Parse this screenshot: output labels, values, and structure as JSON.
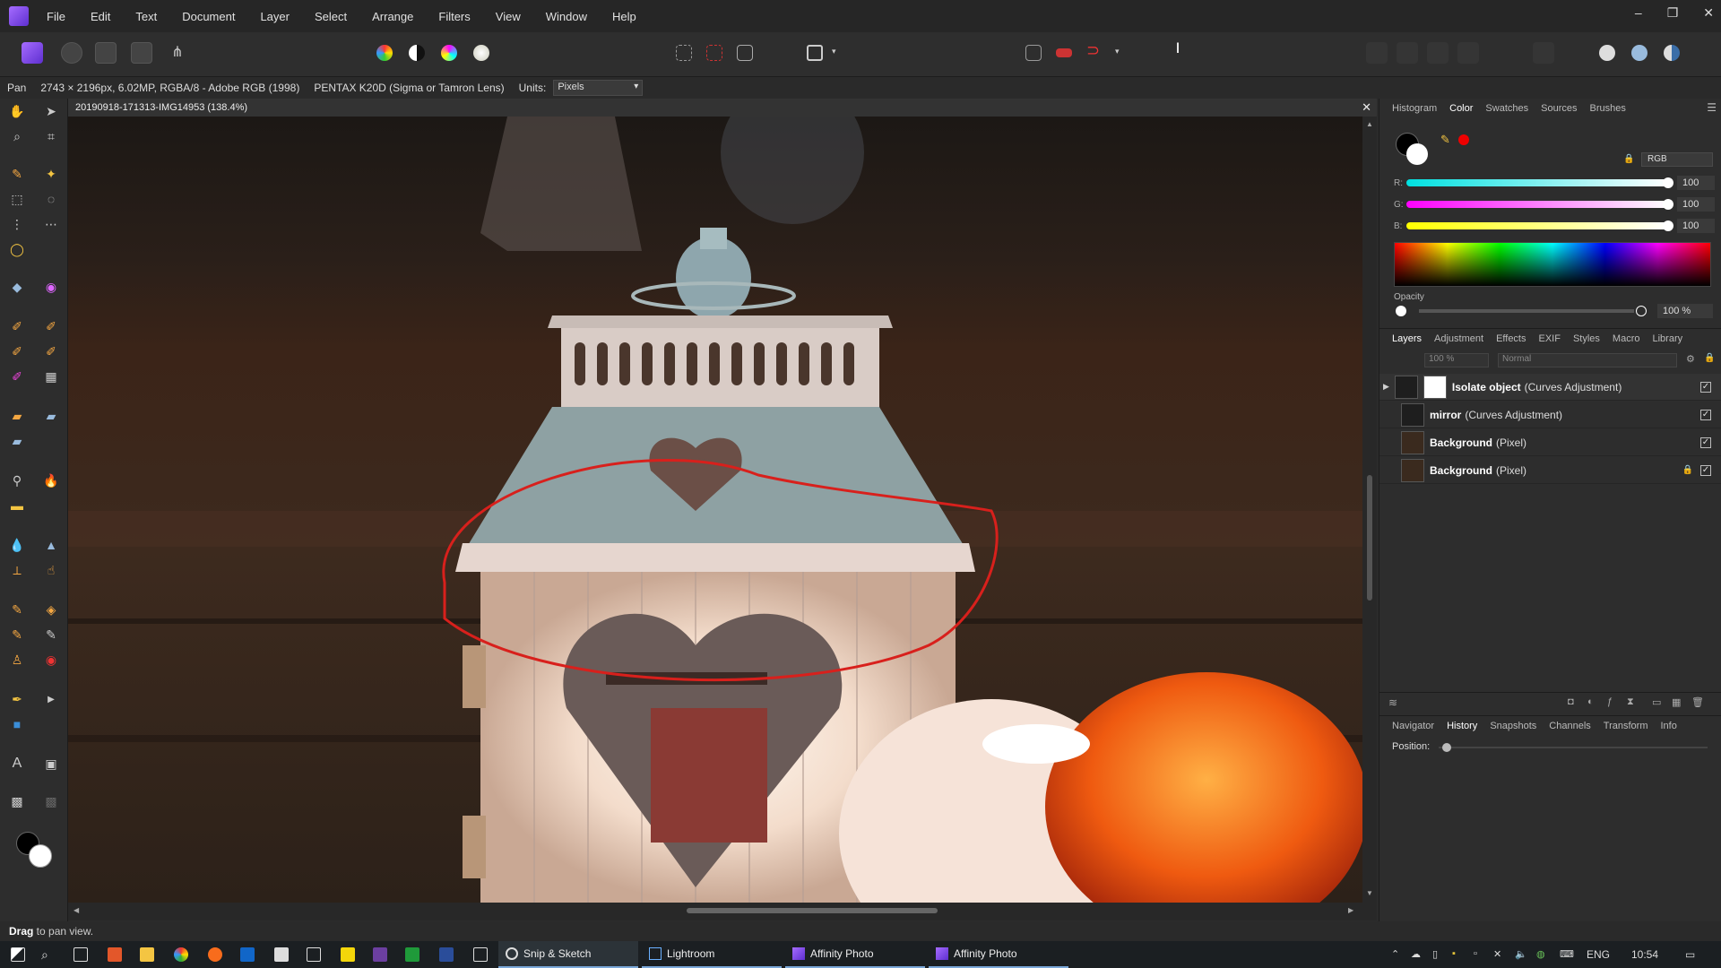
{
  "menu": [
    "File",
    "Edit",
    "Text",
    "Document",
    "Layer",
    "Select",
    "Arrange",
    "Filters",
    "View",
    "Window",
    "Help"
  ],
  "window_controls": [
    "–",
    "❐",
    "✕"
  ],
  "context": {
    "tool": "Pan",
    "info": "2743 × 2196px, 6.02MP, RGBA/8 - Adobe RGB (1998)",
    "camera": "PENTAX K20D (Sigma or Tamron Lens)",
    "units_label": "Units:",
    "units_value": "Pixels"
  },
  "document_tab": {
    "title": "20190918-171313-IMG14953 (138.4%)",
    "close": "✕"
  },
  "color_panel": {
    "tabs": [
      "Histogram",
      "Color",
      "Swatches",
      "Sources",
      "Brushes"
    ],
    "active_tab": "Color",
    "mode": "RGB",
    "channels": [
      {
        "label": "R:",
        "value": "100",
        "gradient": "linear-gradient(90deg,#00e0e0,#ffffff)"
      },
      {
        "label": "G:",
        "value": "100",
        "gradient": "linear-gradient(90deg,#ff00ff,#ffffff)"
      },
      {
        "label": "B:",
        "value": "100",
        "gradient": "linear-gradient(90deg,#ffff00,#ffffff)"
      }
    ],
    "opacity_label": "Opacity",
    "opacity_value": "100 %"
  },
  "layers_panel": {
    "tabs": [
      "Layers",
      "Adjustment",
      "Effects",
      "EXIF",
      "Styles",
      "Macro",
      "Library"
    ],
    "active_tab": "Layers",
    "opacity": "100 %",
    "blend": "Normal",
    "layers": [
      {
        "name": "Isolate object",
        "type": "(Curves Adjustment)",
        "selected": true,
        "locked": false
      },
      {
        "name": "mirror",
        "type": "(Curves Adjustment)",
        "selected": false,
        "locked": false
      },
      {
        "name": "Background",
        "type": "(Pixel)",
        "selected": false,
        "locked": false
      },
      {
        "name": "Background",
        "type": "(Pixel)",
        "selected": false,
        "locked": true
      }
    ]
  },
  "history_panel": {
    "tabs": [
      "Navigator",
      "History",
      "Snapshots",
      "Channels",
      "Transform",
      "Info"
    ],
    "active_tab": "History",
    "position_label": "Position:"
  },
  "status": {
    "bold": "Drag",
    "rest": " to pan view."
  },
  "taskbar": {
    "apps": [
      "Snip & Sketch",
      "Lightroom",
      "Affinity Photo",
      "Affinity Photo"
    ],
    "lang": "ENG",
    "time": "10:54"
  }
}
